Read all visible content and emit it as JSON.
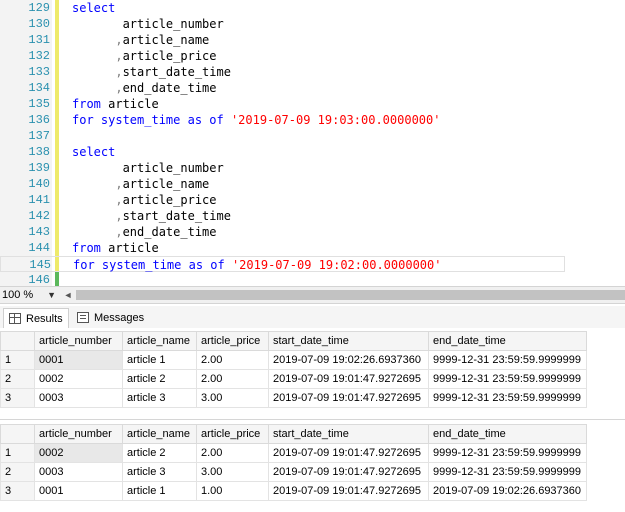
{
  "editor": {
    "lines": [
      {
        "num": "129",
        "parts": [
          {
            "t": "select",
            "c": "kw"
          }
        ]
      },
      {
        "num": "130",
        "parts": [
          {
            "t": "       article_number",
            "c": ""
          }
        ]
      },
      {
        "num": "131",
        "parts": [
          {
            "t": "      ,",
            "c": "gr"
          },
          {
            "t": "article_name",
            "c": ""
          }
        ]
      },
      {
        "num": "132",
        "parts": [
          {
            "t": "      ,",
            "c": "gr"
          },
          {
            "t": "article_price",
            "c": ""
          }
        ]
      },
      {
        "num": "133",
        "parts": [
          {
            "t": "      ,",
            "c": "gr"
          },
          {
            "t": "start_date_time",
            "c": ""
          }
        ]
      },
      {
        "num": "134",
        "parts": [
          {
            "t": "      ,",
            "c": "gr"
          },
          {
            "t": "end_date_time",
            "c": ""
          }
        ]
      },
      {
        "num": "135",
        "parts": [
          {
            "t": "from",
            "c": "kw"
          },
          {
            "t": " article",
            "c": ""
          }
        ]
      },
      {
        "num": "136",
        "parts": [
          {
            "t": "for system_time as of",
            "c": "kw"
          },
          {
            "t": " ",
            "c": ""
          },
          {
            "t": "'2019-07-09 19:03:00.0000000'",
            "c": "str"
          }
        ]
      },
      {
        "num": "137",
        "parts": []
      },
      {
        "num": "138",
        "parts": [
          {
            "t": "select",
            "c": "kw"
          }
        ]
      },
      {
        "num": "139",
        "parts": [
          {
            "t": "       article_number",
            "c": ""
          }
        ]
      },
      {
        "num": "140",
        "parts": [
          {
            "t": "      ,",
            "c": "gr"
          },
          {
            "t": "article_name",
            "c": ""
          }
        ]
      },
      {
        "num": "141",
        "parts": [
          {
            "t": "      ,",
            "c": "gr"
          },
          {
            "t": "article_price",
            "c": ""
          }
        ]
      },
      {
        "num": "142",
        "parts": [
          {
            "t": "      ,",
            "c": "gr"
          },
          {
            "t": "start_date_time",
            "c": ""
          }
        ]
      },
      {
        "num": "143",
        "parts": [
          {
            "t": "      ,",
            "c": "gr"
          },
          {
            "t": "end_date_time",
            "c": ""
          }
        ]
      },
      {
        "num": "144",
        "parts": [
          {
            "t": "from",
            "c": "kw"
          },
          {
            "t": " article",
            "c": ""
          }
        ]
      },
      {
        "num": "145",
        "parts": [
          {
            "t": "for system_time as of",
            "c": "kw"
          },
          {
            "t": " ",
            "c": ""
          },
          {
            "t": "'2019-07-09 19:02:00.0000000'",
            "c": "str"
          }
        ]
      },
      {
        "num": "146",
        "parts": []
      }
    ]
  },
  "status": {
    "zoom": "100 %"
  },
  "tabs": {
    "results": "Results",
    "messages": "Messages"
  },
  "grids": [
    {
      "headers": [
        "article_number",
        "article_name",
        "article_price",
        "start_date_time",
        "end_date_time"
      ],
      "rows": [
        {
          "rn": "1",
          "cells": [
            "0001",
            "article 1",
            "2.00",
            "2019-07-09 19:02:26.6937360",
            "9999-12-31 23:59:59.9999999"
          ]
        },
        {
          "rn": "2",
          "cells": [
            "0002",
            "article 2",
            "2.00",
            "2019-07-09 19:01:47.9272695",
            "9999-12-31 23:59:59.9999999"
          ]
        },
        {
          "rn": "3",
          "cells": [
            "0003",
            "article 3",
            "3.00",
            "2019-07-09 19:01:47.9272695",
            "9999-12-31 23:59:59.9999999"
          ]
        }
      ]
    },
    {
      "headers": [
        "article_number",
        "article_name",
        "article_price",
        "start_date_time",
        "end_date_time"
      ],
      "rows": [
        {
          "rn": "1",
          "cells": [
            "0002",
            "article 2",
            "2.00",
            "2019-07-09 19:01:47.9272695",
            "9999-12-31 23:59:59.9999999"
          ]
        },
        {
          "rn": "2",
          "cells": [
            "0003",
            "article 3",
            "3.00",
            "2019-07-09 19:01:47.9272695",
            "9999-12-31 23:59:59.9999999"
          ]
        },
        {
          "rn": "3",
          "cells": [
            "0001",
            "article 1",
            "1.00",
            "2019-07-09 19:01:47.9272695",
            "2019-07-09 19:02:26.6937360"
          ]
        }
      ]
    }
  ]
}
